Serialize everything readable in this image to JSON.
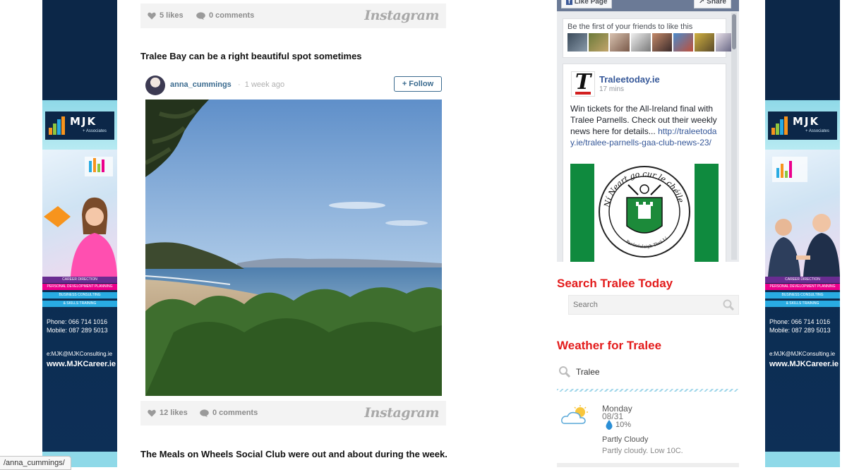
{
  "post1": {
    "likes": "5 likes",
    "comments": "0 comments",
    "brand": "Instagram"
  },
  "post2": {
    "title": "Tralee Bay can be a right beautiful spot sometimes",
    "author": "anna_cummings",
    "separator": "·",
    "time_ago": "1 week ago",
    "follow_label": "Follow",
    "likes": "12 likes",
    "comments": "0 comments",
    "brand": "Instagram"
  },
  "post3": {
    "title": "The Meals on Wheels Social Club were out and about during the week."
  },
  "fb": {
    "like_page": "Like Page",
    "share": "Share",
    "friends_text": "Be the first of your friends to like this",
    "page_name": "Traleetoday.ie",
    "post_time": "17 mins",
    "post_text": "Win tickets for the All-Ireland final with Tralee Parnells. Check out their weekly news here for details...",
    "post_link": "http://traleetoday.ie/tralee-parnells-gaa-club-news-23/",
    "crest_top": "Ní Neart go cur le chéile",
    "crest_bottom": "Paránéalaigh Thrá Lí"
  },
  "search": {
    "title": "Search Tralee Today",
    "placeholder": "Search"
  },
  "weather": {
    "title": "Weather for Tralee",
    "location": "Tralee",
    "day": "Monday",
    "date": "08/31",
    "rain_chance": "10%",
    "condition": "Partly Cloudy",
    "description": "Partly cloudy. Low 10C."
  },
  "ads": {
    "brand": "MJK",
    "brand_sub": "+ Associates",
    "strip1": "Career Direction",
    "strip2": "Personal Development Planning",
    "strip3": "Business Consulting",
    "strip4": "& Skills Training",
    "phone": "Phone: 066 714 1016",
    "mobile": "Mobile: 087 289 5013",
    "email": "e:MJK@MJKConsulting.ie",
    "web": "www.MJKCareer.ie"
  },
  "status_bar": {
    "url": "/anna_cummings/"
  },
  "colors": {
    "accent_red": "#e31b1b",
    "link_blue": "#365899",
    "ad_navy": "#0c2748",
    "ad_cyan": "#8fd9e8"
  }
}
